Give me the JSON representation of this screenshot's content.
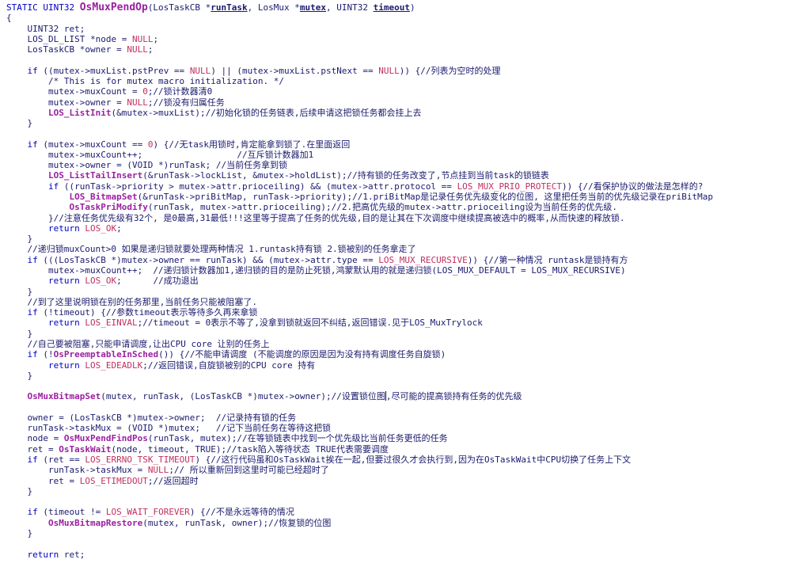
{
  "lines": [
    [
      [
        "kw",
        "STATIC UINT32 "
      ],
      [
        "fnt",
        "OsMuxPendOp"
      ],
      [
        "pl",
        "(LosTaskCB *"
      ],
      [
        "p",
        "runTask"
      ],
      [
        "pl",
        ", LosMux *"
      ],
      [
        "p",
        "mutex"
      ],
      [
        "pl",
        ", UINT32 "
      ],
      [
        "p",
        "timeout"
      ],
      [
        "pl",
        ")"
      ]
    ],
    [
      [
        "br",
        "{"
      ]
    ],
    [
      [
        "pl",
        "    UINT32 ret;"
      ]
    ],
    [
      [
        "pl",
        "    LOS_DL_LIST *node = "
      ],
      [
        "mac",
        "NULL"
      ],
      [
        "pl",
        ";"
      ]
    ],
    [
      [
        "pl",
        "    LosTaskCB *owner = "
      ],
      [
        "mac",
        "NULL"
      ],
      [
        "pl",
        ";"
      ]
    ],
    [],
    [
      [
        "pl",
        "    "
      ],
      [
        "kw",
        "if"
      ],
      [
        "pl",
        " ((mutex->muxList.pstPrev == "
      ],
      [
        "mac",
        "NULL"
      ],
      [
        "pl",
        ") || (mutex->muxList.pstNext == "
      ],
      [
        "mac",
        "NULL"
      ],
      [
        "pl",
        ")) {//列表为空时的处理"
      ]
    ],
    [
      [
        "pl",
        "        /* This is for mutex macro initialization. */"
      ]
    ],
    [
      [
        "pl",
        "        mutex->muxCount = "
      ],
      [
        "mac",
        "0"
      ],
      [
        "pl",
        ";//锁计数器清0"
      ]
    ],
    [
      [
        "pl",
        "        mutex->owner = "
      ],
      [
        "mac",
        "NULL"
      ],
      [
        "pl",
        ";//锁没有归属任务"
      ]
    ],
    [
      [
        "pl",
        "        "
      ],
      [
        "fn",
        "LOS_ListInit"
      ],
      [
        "pl",
        "(&mutex->muxList);//初始化锁的任务链表,后续申请这把锁任务都会挂上去"
      ]
    ],
    [
      [
        "pl",
        "    }"
      ]
    ],
    [],
    [
      [
        "pl",
        "    "
      ],
      [
        "kw",
        "if"
      ],
      [
        "pl",
        " (mutex->muxCount == "
      ],
      [
        "mac",
        "0"
      ],
      [
        "pl",
        ") {//无task用锁时,肯定能拿到锁了.在里面返回"
      ]
    ],
    [
      [
        "pl",
        "        mutex->muxCount++;                  //互斥锁计数器加1"
      ]
    ],
    [
      [
        "pl",
        "        mutex->owner = (VOID *)runTask; //当前任务拿到锁"
      ]
    ],
    [
      [
        "pl",
        "        "
      ],
      [
        "fn",
        "LOS_ListTailInsert"
      ],
      [
        "pl",
        "(&runTask->lockList, &mutex->holdList);//持有锁的任务改变了,节点挂到当前task的锁链表"
      ]
    ],
    [
      [
        "pl",
        "        "
      ],
      [
        "kw",
        "if"
      ],
      [
        "pl",
        " ((runTask->priority > mutex->attr.prioceiling) && (mutex->attr.protocol == "
      ],
      [
        "mac",
        "LOS_MUX_PRIO_PROTECT"
      ],
      [
        "pl",
        ")) {//看保护协议的做法是怎样的?"
      ]
    ],
    [
      [
        "pl",
        "            "
      ],
      [
        "fn",
        "LOS_BitmapSet"
      ],
      [
        "pl",
        "(&runTask->priBitMap, runTask->priority);//1.priBitMap是记录任务优先级变化的位图, 这里把任务当前的优先级记录在priBitMap"
      ]
    ],
    [
      [
        "pl",
        "            "
      ],
      [
        "fn",
        "OsTaskPriModify"
      ],
      [
        "pl",
        "(runTask, mutex->attr.prioceiling);//2.把高优先级的mutex->attr.prioceiling设为当前任务的优先级."
      ]
    ],
    [
      [
        "pl",
        "        }//注意任务优先级有32个, 是0最高,31最低!!!这里等于提高了任务的优先级,目的是让其在下次调度中继续提高被选中的概率,从而快速的释放锁."
      ]
    ],
    [
      [
        "pl",
        "        "
      ],
      [
        "kw",
        "return"
      ],
      [
        "pl",
        " "
      ],
      [
        "mac",
        "LOS_OK"
      ],
      [
        "pl",
        ";"
      ]
    ],
    [
      [
        "pl",
        "    }"
      ]
    ],
    [
      [
        "pl",
        "    //递归锁muxCount>0 如果是递归锁就要处理两种情况 1.runtask持有锁 2.锁被别的任务拿走了"
      ]
    ],
    [
      [
        "pl",
        "    "
      ],
      [
        "kw",
        "if"
      ],
      [
        "pl",
        " (((LosTaskCB *)mutex->owner == runTask) && (mutex->attr.type == "
      ],
      [
        "mac",
        "LOS_MUX_RECURSIVE"
      ],
      [
        "pl",
        ")) {//第一种情况 runtask是锁持有方"
      ]
    ],
    [
      [
        "pl",
        "        mutex->muxCount++;  //递归锁计数器加1,递归锁的目的是防止死锁,鸿蒙默认用的就是递归锁(LOS_MUX_DEFAULT = LOS_MUX_RECURSIVE)"
      ]
    ],
    [
      [
        "pl",
        "        "
      ],
      [
        "kw",
        "return"
      ],
      [
        "pl",
        " "
      ],
      [
        "mac",
        "LOS_OK"
      ],
      [
        "pl",
        ";      //成功退出"
      ]
    ],
    [
      [
        "pl",
        "    }"
      ]
    ],
    [
      [
        "pl",
        "    //到了这里说明锁在别的任务那里,当前任务只能被阻塞了."
      ]
    ],
    [
      [
        "pl",
        "    "
      ],
      [
        "kw",
        "if"
      ],
      [
        "pl",
        " (!timeout) {//参数timeout表示等待多久再来拿锁"
      ]
    ],
    [
      [
        "pl",
        "        "
      ],
      [
        "kw",
        "return"
      ],
      [
        "pl",
        " "
      ],
      [
        "mac",
        "LOS_EINVAL"
      ],
      [
        "pl",
        ";//timeout = 0表示不等了,没拿到锁就返回不纠结,返回错误.见于LOS_MuxTrylock"
      ]
    ],
    [
      [
        "pl",
        "    }"
      ]
    ],
    [
      [
        "pl",
        "    //自己要被阻塞,只能申请调度,让出CPU core 让别的任务上"
      ]
    ],
    [
      [
        "pl",
        "    "
      ],
      [
        "kw",
        "if"
      ],
      [
        "pl",
        " (!"
      ],
      [
        "fn",
        "OsPreemptableInSched"
      ],
      [
        "pl",
        "()) {//不能申请调度 (不能调度的原因是因为没有持有调度任务自旋锁)"
      ]
    ],
    [
      [
        "pl",
        "        "
      ],
      [
        "kw",
        "return"
      ],
      [
        "pl",
        " "
      ],
      [
        "mac",
        "LOS_EDEADLK"
      ],
      [
        "pl",
        ";//返回错误,自旋锁被别的CPU core 持有"
      ]
    ],
    [
      [
        "pl",
        "    }"
      ]
    ],
    [],
    [
      [
        "pl",
        "    "
      ],
      [
        "fn",
        "OsMuxBitmapSet"
      ],
      [
        "pl",
        "(mutex, runTask, (LosTaskCB *)mutex->owner);//设置锁位图"
      ],
      [
        "caret",
        ""
      ],
      [
        "pl",
        ",尽可能的提高锁持有任务的优先级"
      ]
    ],
    [],
    [
      [
        "pl",
        "    owner = (LosTaskCB *)mutex->owner;  //记录持有锁的任务"
      ]
    ],
    [
      [
        "pl",
        "    runTask->taskMux = (VOID *)mutex;   //记下当前任务在等待这把锁"
      ]
    ],
    [
      [
        "pl",
        "    node = "
      ],
      [
        "fn",
        "OsMuxPendFindPos"
      ],
      [
        "pl",
        "(runTask, mutex);//在等锁链表中找到一个优先级比当前任务更低的任务"
      ]
    ],
    [
      [
        "pl",
        "    ret = "
      ],
      [
        "fn",
        "OsTaskWait"
      ],
      [
        "pl",
        "(node, timeout, TRUE);//task陷入等待状态 TRUE代表需要调度"
      ]
    ],
    [
      [
        "pl",
        "    "
      ],
      [
        "kw",
        "if"
      ],
      [
        "pl",
        " (ret == "
      ],
      [
        "mac",
        "LOS_ERRNO_TSK_TIMEOUT"
      ],
      [
        "pl",
        ") {//这行代码虽和OsTaskWait挨在一起,但要过很久才会执行到,因为在OsTaskWait中CPU切换了任务上下文"
      ]
    ],
    [
      [
        "pl",
        "        runTask->taskMux = "
      ],
      [
        "mac",
        "NULL"
      ],
      [
        "pl",
        ";// 所以重新回到这里时可能已经超时了"
      ]
    ],
    [
      [
        "pl",
        "        ret = "
      ],
      [
        "mac",
        "LOS_ETIMEDOUT"
      ],
      [
        "pl",
        ";//返回超时"
      ]
    ],
    [
      [
        "pl",
        "    }"
      ]
    ],
    [],
    [
      [
        "pl",
        "    "
      ],
      [
        "kw",
        "if"
      ],
      [
        "pl",
        " (timeout != "
      ],
      [
        "mac",
        "LOS_WAIT_FOREVER"
      ],
      [
        "pl",
        ") {//不是永远等待的情况"
      ]
    ],
    [
      [
        "pl",
        "        "
      ],
      [
        "fn",
        "OsMuxBitmapRestore"
      ],
      [
        "pl",
        "(mutex, runTask, owner);//恢复锁的位图"
      ]
    ],
    [
      [
        "pl",
        "    }"
      ]
    ],
    [],
    [
      [
        "pl",
        "    "
      ],
      [
        "kw",
        "return"
      ],
      [
        "pl",
        " ret;"
      ]
    ]
  ]
}
